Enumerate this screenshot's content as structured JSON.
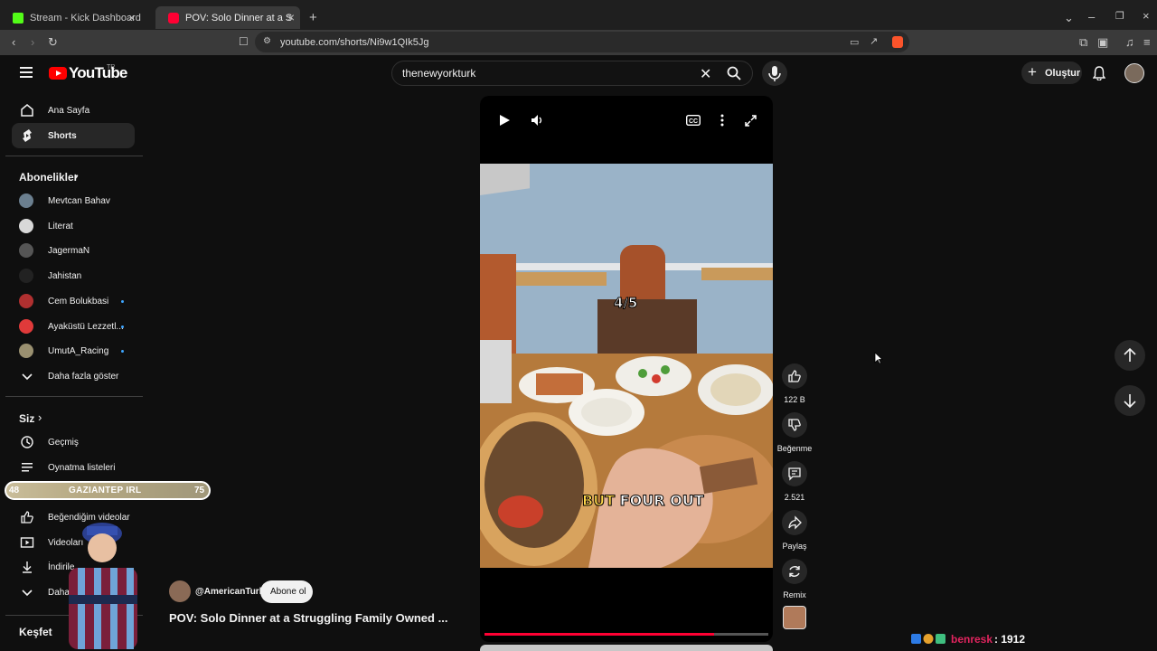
{
  "browser": {
    "tabs": [
      {
        "title": "Stream - Kick Dashboard",
        "color": "#53fc18"
      },
      {
        "title": "POV: Solo Dinner at a Struggling",
        "color": "#ff0033"
      }
    ],
    "url": "youtube.com/shorts/Ni9w1QIk5Jg"
  },
  "youtube": {
    "logo_text": "YouTube",
    "logo_tr": "TR",
    "search_value": "thenewyorkturk",
    "create_label": "Oluştur"
  },
  "sidebar": {
    "nav": [
      {
        "label": "Ana Sayfa",
        "icon": "home-icon"
      },
      {
        "label": "Shorts",
        "icon": "shorts-icon"
      }
    ],
    "subs_header": "Abonelikler",
    "subscriptions": [
      {
        "label": "Mevtcan Bahav",
        "avatar_color": "#6b7f8f",
        "new": false
      },
      {
        "label": "Literat",
        "avatar_color": "#d8d8d8",
        "new": false
      },
      {
        "label": "JagermaN",
        "avatar_color": "#555555",
        "new": false
      },
      {
        "label": "Jahistan",
        "avatar_color": "#222222",
        "new": false
      },
      {
        "label": "Cem Bolukbasi",
        "avatar_color": "#b03030",
        "new": true
      },
      {
        "label": "Ayaküstü Lezzetl...",
        "avatar_color": "#e03a3a",
        "new": true
      },
      {
        "label": "UmutA_Racing",
        "avatar_color": "#9a9070",
        "new": true
      }
    ],
    "show_more": "Daha fazla göster",
    "you_header": "Siz",
    "you_items": [
      {
        "label": "Geçmiş",
        "icon": "history-icon"
      },
      {
        "label": "Oynatma listeleri",
        "icon": "playlists-icon"
      },
      {
        "label": "Beğendiğim videolar",
        "icon": "like-icon"
      },
      {
        "label": "Videoları",
        "icon": "videos-icon"
      },
      {
        "label": "İndirile",
        "icon": "download-icon"
      },
      {
        "label": "Daha",
        "icon": "chevron-down-icon"
      }
    ],
    "explore_header": "Keşfet"
  },
  "overlay": {
    "left_num": "48",
    "title": "GAZIANTEP IRL",
    "right_num": "75"
  },
  "video": {
    "overlay_rating": "4/5",
    "caption_first": "BUT",
    "caption_rest": " FOUR OUT",
    "progress": 0.81
  },
  "actions": [
    {
      "label": "122 B",
      "icon": "thumbs-up-icon"
    },
    {
      "label": "Beğenme",
      "icon": "thumbs-down-icon"
    },
    {
      "label": "2.521",
      "icon": "comment-icon"
    },
    {
      "label": "Paylaş",
      "icon": "share-icon"
    },
    {
      "label": "Remix",
      "icon": "remix-icon"
    }
  ],
  "channel": {
    "handle": "@AmericanTurk",
    "subscribe_label": "Abone ol",
    "title": "POV: Solo Dinner at a Struggling Family Owned ..."
  },
  "stream": {
    "user": "benresk",
    "count": ": 1912"
  },
  "colors": {
    "accent": "#ff0033",
    "link": "#3ea6ff"
  }
}
